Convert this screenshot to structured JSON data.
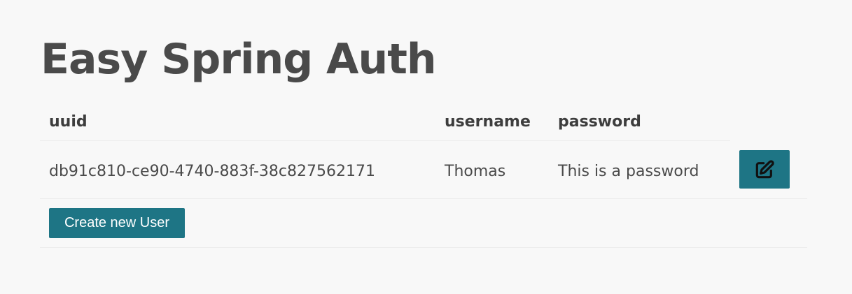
{
  "page": {
    "title": "Easy Spring Auth"
  },
  "table": {
    "columns": [
      "uuid",
      "username",
      "password"
    ],
    "rows": [
      {
        "uuid": "db91c810-ce90-4740-883f-38c827562171",
        "username": "Thomas",
        "password": "This is a password",
        "action_icon": "edit-icon"
      }
    ]
  },
  "actions": {
    "create_label": "Create new User"
  },
  "colors": {
    "accent": "#1e7585",
    "background": "#f8f8f8",
    "text": "#4a4a4a"
  }
}
